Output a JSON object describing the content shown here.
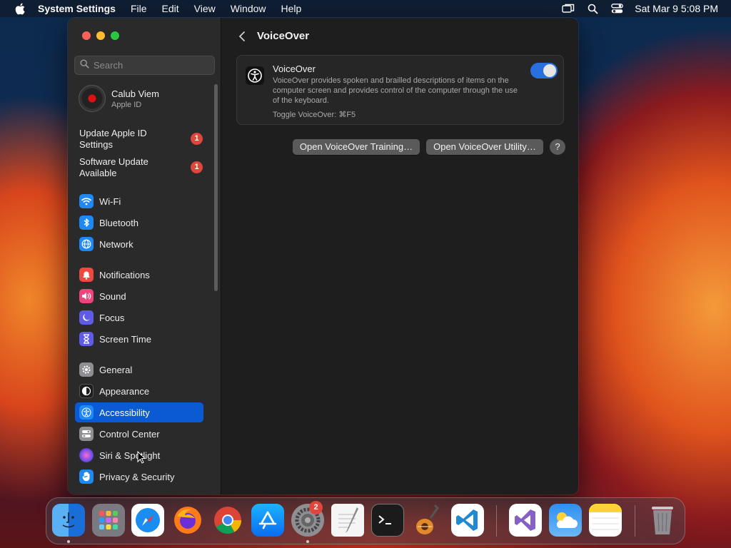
{
  "menubar": {
    "app_name": "System Settings",
    "items": [
      "File",
      "Edit",
      "View",
      "Window",
      "Help"
    ],
    "clock": "Sat Mar 9  5:08 PM"
  },
  "sidebar": {
    "search_placeholder": "Search",
    "profile": {
      "name": "Calub Viem",
      "subtitle": "Apple ID"
    },
    "alerts": [
      {
        "label": "Update Apple ID Settings",
        "count": "1"
      },
      {
        "label": "Software Update Available",
        "count": "1"
      }
    ],
    "items": [
      {
        "label": "Wi-Fi",
        "icon": "wifi-icon",
        "color": "#1e88f5"
      },
      {
        "label": "Bluetooth",
        "icon": "bluetooth-icon",
        "color": "#1e88f5"
      },
      {
        "label": "Network",
        "icon": "globe-icon",
        "color": "#1e88f5"
      },
      {
        "label": "Notifications",
        "icon": "bell-icon",
        "color": "#f0483e"
      },
      {
        "label": "Sound",
        "icon": "speaker-icon",
        "color": "#f0437a"
      },
      {
        "label": "Focus",
        "icon": "moon-icon",
        "color": "#5e5ce6"
      },
      {
        "label": "Screen Time",
        "icon": "hourglass-icon",
        "color": "#5e5ce6"
      },
      {
        "label": "General",
        "icon": "gear-icon",
        "color": "#8e8e93"
      },
      {
        "label": "Appearance",
        "icon": "appearance-icon",
        "color": "#1c1c1e"
      },
      {
        "label": "Accessibility",
        "icon": "accessibility-icon",
        "color": "#1e88f5"
      },
      {
        "label": "Control Center",
        "icon": "toggles-icon",
        "color": "#8e8e93"
      },
      {
        "label": "Siri & Spotlight",
        "icon": "siri-icon",
        "color": "#6b4ee8"
      },
      {
        "label": "Privacy & Security",
        "icon": "hand-icon",
        "color": "#1e88f5"
      }
    ],
    "active_item": "Accessibility"
  },
  "content": {
    "title": "VoiceOver",
    "card": {
      "title": "VoiceOver",
      "description": "VoiceOver provides spoken and brailled descriptions of items on the computer screen and provides control of the computer through the use of the keyboard.",
      "shortcut": "Toggle VoiceOver: ⌘F5",
      "enabled": true
    },
    "buttons": {
      "training": "Open VoiceOver Training…",
      "utility": "Open VoiceOver Utility…",
      "help": "?"
    }
  },
  "dock": {
    "apps": [
      "finder",
      "launchpad",
      "safari",
      "firefox",
      "chrome",
      "app-store",
      "system-settings",
      "textedit",
      "terminal",
      "garageband",
      "vscode",
      "visual-studio",
      "weather",
      "notes",
      "trash"
    ],
    "system_settings_badge": "2"
  },
  "colors": {
    "accent": "#0a5ad4",
    "toggle_on": "#2a6fe0",
    "badge": "#e2453c"
  }
}
